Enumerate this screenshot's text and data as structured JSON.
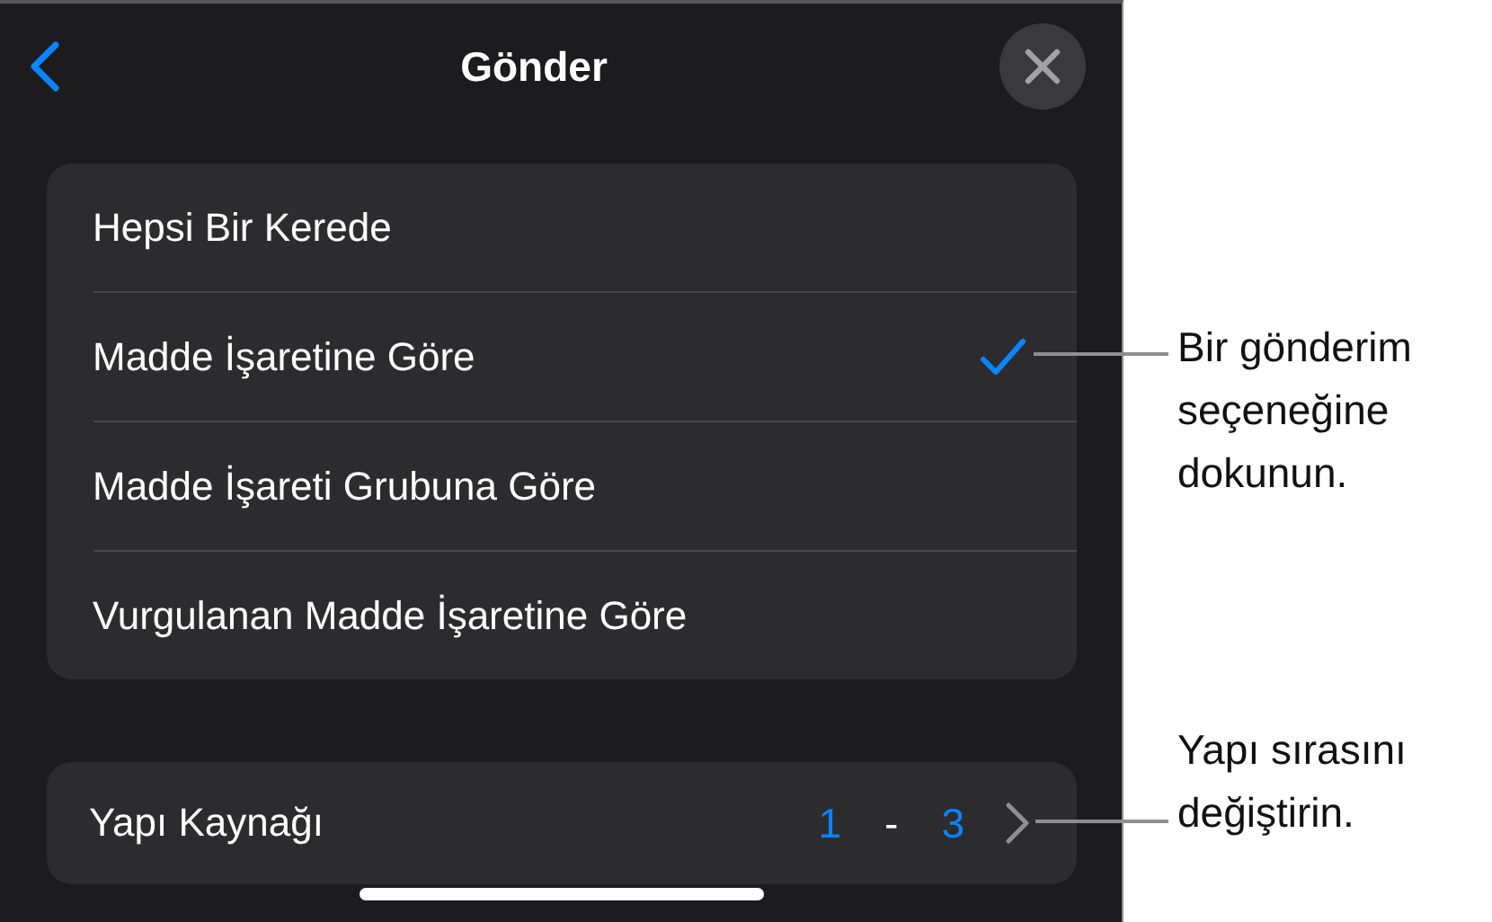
{
  "header": {
    "title": "Gönder"
  },
  "options": [
    {
      "label": "Hepsi Bir Kerede",
      "selected": false
    },
    {
      "label": "Madde İşaretine Göre",
      "selected": true
    },
    {
      "label": "Madde İşareti Grubuna Göre",
      "selected": false
    },
    {
      "label": "Vurgulanan Madde İşaretine Göre",
      "selected": false
    }
  ],
  "build_source": {
    "label": "Yapı Kaynağı",
    "from": "1",
    "separator": "-",
    "to": "3"
  },
  "callouts": [
    {
      "text": "Bir gönderim\nseçeneğine\ndokunun."
    },
    {
      "text": "Yapı sırasını\ndeğiştirin."
    }
  ]
}
